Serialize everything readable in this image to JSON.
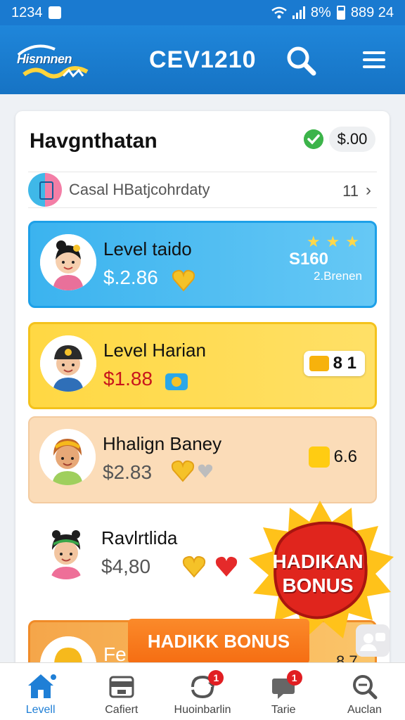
{
  "status_bar": {
    "time": "1234",
    "battery": "8%",
    "clock": "889 24"
  },
  "app_bar": {
    "logo_text": "Hisnnnen",
    "title": "CEV1210"
  },
  "card": {
    "title": "Havgnthatan",
    "balance": "$.00",
    "filter": {
      "label": "Casal HBatjcohrdaty",
      "count": "11"
    }
  },
  "levels": [
    {
      "name": "Level taido",
      "price": "$.2.86",
      "reward_amount": "S160",
      "reward_sub": "2.Brenen"
    },
    {
      "name": "Level Harian",
      "price": "$1.88",
      "tag_value": "8 1"
    },
    {
      "name": "Hhalign Baney",
      "price": "$2.83",
      "tag_value": "6.6"
    },
    {
      "name": "Ravlrtlida",
      "price": "$4,80"
    },
    {
      "name": "Fe",
      "value": "8.7"
    }
  ],
  "bonus_burst_text": "HADIKAN BONUS",
  "bonus_banner_text": "HADIKK BONUS",
  "bottom_nav": [
    {
      "label": "Levell",
      "badge": ""
    },
    {
      "label": "Cafiert",
      "badge": ""
    },
    {
      "label": "Huoinbarlin",
      "badge": "1"
    },
    {
      "label": "Tarie",
      "badge": "1"
    },
    {
      "label": "Auclan",
      "badge": ""
    }
  ],
  "colors": {
    "brand_blue": "#1a7ad0",
    "level_blue": "#3bb3ef",
    "level_yellow": "#ffd843",
    "level_peach": "#fbdcb8",
    "bonus_red": "#e0251d",
    "bonus_orange": "#f56d12"
  }
}
